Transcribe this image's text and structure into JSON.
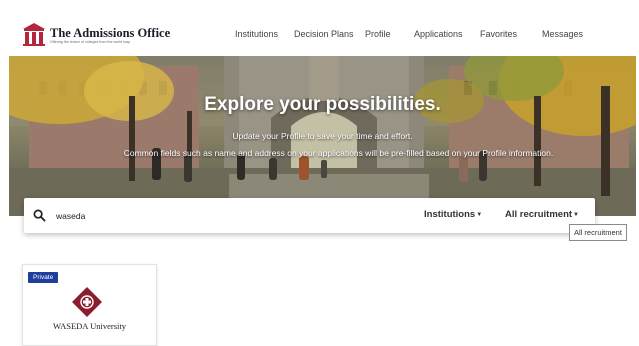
{
  "brand": {
    "name": "The Admissions Office",
    "tagline": "Offering the choice of colleges from the world map"
  },
  "nav": {
    "items": [
      {
        "label": "Institutions"
      },
      {
        "label": "Decision Plans"
      },
      {
        "label": "Profile"
      },
      {
        "label": "Applications"
      },
      {
        "label": "Favorites"
      },
      {
        "label": "Messages"
      }
    ]
  },
  "hero": {
    "title": "Explore your possibilities.",
    "subtitle_1": "Update your Profile to save your time and effort.",
    "subtitle_2": "Common fields such as name and address on your applications will be pre-filled based on your Profile information."
  },
  "search": {
    "value": "waseda",
    "placeholder": "",
    "filters": [
      {
        "label": "Institutions"
      },
      {
        "label": "All recruitment"
      }
    ]
  },
  "tooltip": {
    "text": "All recruitment"
  },
  "results": [
    {
      "badge": "Private",
      "name": "WASEDA University"
    }
  ],
  "colors": {
    "badge": "#1f3d9a",
    "logo_red": "#b3263b",
    "seal": "#8c1d2f"
  }
}
